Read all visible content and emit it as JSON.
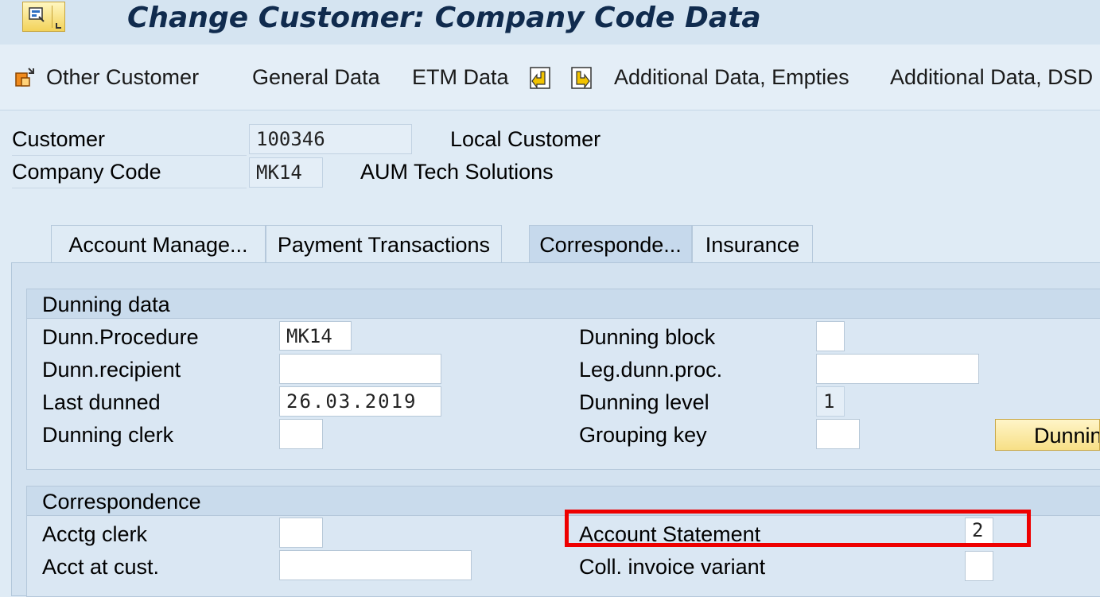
{
  "header": {
    "title": "Change Customer: Company Code Data"
  },
  "toolbar": {
    "other_customer": "Other Customer",
    "general_data": "General Data",
    "etm_data": "ETM Data",
    "additional_empties": "Additional Data, Empties",
    "additional_dsd": "Additional Data, DSD"
  },
  "customer": {
    "customer_label": "Customer",
    "customer_value": "100346",
    "customer_desc": "Local Customer",
    "company_label": "Company Code",
    "company_value": "MK14",
    "company_desc": "AUM Tech Solutions"
  },
  "tabs": [
    {
      "label": "Account Manage..."
    },
    {
      "label": "Payment Transactions"
    },
    {
      "label": "Corresponde..."
    },
    {
      "label": "Insurance"
    }
  ],
  "dunning": {
    "heading": "Dunning data",
    "procedure_label": "Dunn.Procedure",
    "procedure_value": "MK14",
    "recipient_label": "Dunn.recipient",
    "recipient_value": "",
    "last_dunned_label": "Last dunned",
    "last_dunned_value": "26.03.2019",
    "clerk_label": "Dunning clerk",
    "clerk_value": "",
    "block_label": "Dunning block",
    "block_value": "",
    "legal_label": "Leg.dunn.proc.",
    "legal_value": "",
    "level_label": "Dunning level",
    "level_value": "1",
    "grouping_label": "Grouping key",
    "grouping_value": "",
    "button_label": "Dunnin"
  },
  "correspondence": {
    "heading": "Correspondence",
    "acctg_clerk_label": "Acctg clerk",
    "acctg_clerk_value": "",
    "acct_at_cust_label": "Acct at cust.",
    "acct_at_cust_value": "",
    "statement_label": "Account Statement",
    "statement_value": "2",
    "coll_invoice_label": "Coll. invoice variant",
    "coll_invoice_value": ""
  },
  "colors": {
    "highlight": "#ee0000",
    "title": "#102b4e"
  }
}
